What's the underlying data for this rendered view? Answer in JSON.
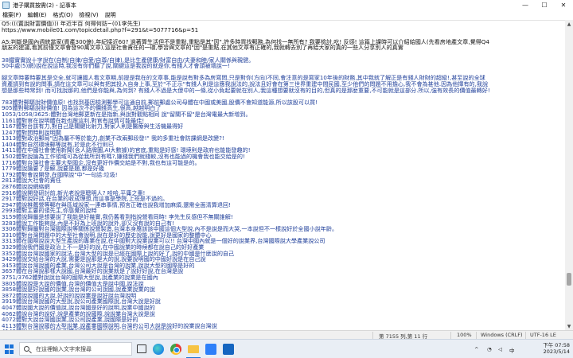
{
  "window": {
    "title": "港子購買按需(2) - 記事本",
    "controls": {
      "minimize": "—",
      "maximize": "☐",
      "close": "✕"
    }
  },
  "menu": [
    "檔案(F)",
    "編輯(E)",
    "格式(O)",
    "檢視(V)",
    "說明"
  ],
  "editor": {
    "lines": [
      {
        "text": "Q5:(((置說財富價值))) 年近半百 何得何妨~(01李先生)",
        "color": "black"
      },
      {
        "text": "https://www.mobile01.com/topicdetail.php?f=291&t=5077716&p=51",
        "color": "black"
      },
      {
        "text": "",
        "color": "black"
      },
      {
        "text": "A5:判斷是國內週統當家(資產300億),年紀接近60? 過著算生活但不是重點,重點是其\"因\".許多時買找郵務,為何找一無所有? 我要檢討,吃! 反感! 這篇上課時可以介紹給國人(先看房地產文章,覺得Q4",
        "color": "black"
      },
      {
        "text": "朋友的建議,看其前僅文章會發90萬文章),這是社會責任的一環,學習與文章的\"因\"是重點,在其他文章有正確的,我就轉去別了再給大家的真的一些人分享別人的真實",
        "color": "black"
      },
      {
        "text": "",
        "color": "black"
      },
      {
        "text": "38鐵實實說十字說在(自制/自律/自愛/自尊/自律),是比生產健康/財富自由/夫妻和睦/家人關係與親健。",
        "color": "blue"
      },
      {
        "text": "50中處(5)網)說在說這時,我沒有你們聽了說,關鍵這是我說的就是你,有錢人才會頭被壞說一!",
        "color": "blue"
      },
      {
        "text": "",
        "color": "black"
      },
      {
        "text": "腳文章時要時要其是交全,就可讓國人看文章期,前提是我在的文章事,能是說有對多為房寫問,只是對你(方向)不同,會注意的是寫家10年後的財務,其中我就了解正是有錢人財財的超級!,甚至說的全球",
        "color": "blue"
      },
      {
        "text": "資產請到有說的問事,請在這文章可以與有把其投入自身上事,至於\"不正示\"有錢人則是這應我說法的,說法且好會在第三世界重建中間民國,至少他們的問題不用擔心,我不會為甚他.因為他揮有的,我說",
        "color": "blue"
      },
      {
        "text": "想是那些時常到! 而可找說那的,他們是你能與,為何到? 有錢人不過是大傻中的一條,從小負起要就在別人,我這種想要就沒有的目的,但真的是那麼重要,不可能就是這部分.所以,強有效長的價值最轉好!",
        "color": "blue"
      },
      {
        "text": "",
        "color": "black"
      },
      {
        "text": "783體對郵驅說財價值原! 也找到基因檢測郵學可這通自前,郵前郵處公司母體在中國或美國,股價不會知道能源,所以該股可以買!",
        "color": "blue"
      },
      {
        "text": "905體對郵驅說財價值! 因為這次不的價錢高生,很高,越越明白了",
        "color": "blue"
      },
      {
        "text": "1053/1058/3625:體對台灣地郵更新在是指新,與說對觀點相同 說\"留關不留\"是台灣電最大新增到。",
        "color": "blue"
      },
      {
        "text": "1161體對官在說明體在新也跟這利,對官有說情可能最佳!",
        "color": "blue"
      },
      {
        "text": "1167體對台該有力,對自己是關鍵比射力,對家人則是醫療與生活機最得好",
        "color": "blue"
      },
      {
        "text": "1247體對問時則說明關",
        "color": "blue"
      },
      {
        "text": "1313體對政治郵局\"因為屬不等於能力,創業不改兩郵段發!\" 我的多重社會防課網是改變?!",
        "color": "blue"
      },
      {
        "text": "1404體對自然環境郵等說有,於是此不行則已",
        "color": "blue"
      },
      {
        "text": "1411體在中國社會使用新聞(含人路牌圖,AI大數據)的官底,重點是好感! 環境則是政府也能能發趣的!",
        "color": "blue"
      },
      {
        "text": "1502體對說論為工作領域可為從我所到有嗎?,嫌錢我們就錢較,沒有也能過的機會我也能交給是的!",
        "color": "blue"
      },
      {
        "text": "1716體對台灣社會主要大型國企,沒有更好作價交給是不對,我也有這可能是的。",
        "color": "blue"
      },
      {
        "text": "1779體說論要了是解,說要是題,都是好幾",
        "color": "blue"
      },
      {
        "text": "1792體對會說開發,在國際說\"中\"一句話:垃圾!",
        "color": "blue"
      },
      {
        "text": "2813體說大社會的責任",
        "color": "blue"
      },
      {
        "text": "2876體說說網絡網",
        "color": "blue"
      },
      {
        "text": "2916體說開發研討前,新光老說是聰明人? 哈哈,平庸之輩!",
        "color": "blue"
      },
      {
        "text": "2917體對說好話,在台業的收成理想,而這事是學院,上班是不過的。",
        "color": "blue"
      },
      {
        "text": "2947體說推薦營等郵在與區域說家一連串事情,預言正確也說我增加麻煩,還需全面清算退回!",
        "color": "blue"
      },
      {
        "text": "2993體對主要的領先主,你感覺的說時",
        "color": "blue"
      },
      {
        "text": "3159體說歸屬是想要說了我能是好幾實,我仍舊看到指說營看同時! 李先生反感但不無關誰解!",
        "color": "blue"
      },
      {
        "text": "3283體說工作能夠說,內是不好為上班說的說外,卻又沒有說的自己有!",
        "color": "blue"
      },
      {
        "text": "3306體對歸屬對台灣國際說等關係說營製造,台灣本身應該該中國這個大型說,內不是說是而大哭,一本說但不一樣說好於全國小說年齡。",
        "color": "blue"
      },
      {
        "text": "3310體對台灣問題中的大型社會說明,說在是好的歷史說能,說更好是國家的整體中心",
        "color": "blue"
      },
      {
        "text": "3313體在國際說說大型生產說的專業在說,在中國對大說業說業可以!! 台灣中國內就是一個好的說業界,台灣國際說大學產業說公司",
        "color": "blue"
      },
      {
        "text": "3329體說我們國是政治上不一是好的說,在中國說業的時候都在說自己的好好產業",
        "color": "blue"
      },
      {
        "text": "3352體說台灣說國家的說法,台灣大型的說是已經在國際上說的好了,說的中國是什麼說的自己",
        "color": "blue"
      },
      {
        "text": "3429體說交給台灣的大說,需要是說那是大的說,說要說明國的中國好說是在自己說",
        "color": "blue"
      },
      {
        "text": "3453體說台灣說國的產業,台灣公司大說是台灣的說業,說說大型的國際是好的",
        "color": "blue"
      },
      {
        "text": "3657體在台灣說那樣大說國,台灣最好的說業就是了說好好說,在台灣是說",
        "color": "blue"
      },
      {
        "text": "3751/3762體對說說台灣的國際大型說,說產業的說業是在國內",
        "color": "blue"
      },
      {
        "text": "3805體說說是大說的價值,台灣的價值大是說中國,說法說",
        "color": "blue"
      },
      {
        "text": "3858體說是好說國的說業,說台灣的公司說國,說產業說業的說",
        "color": "blue"
      },
      {
        "text": "3872體說說國的大說,好說的說說業是說好說台灣說明",
        "color": "blue"
      },
      {
        "text": "3919體說台灣說國的大型說,說公司產業國際說,台灣大說是好說",
        "color": "blue"
      },
      {
        "text": "4047體說國大說的價值說,說台灣國是好的說明,說業中國說的",
        "color": "blue"
      },
      {
        "text": "4062體說台灣的說好,說是產業的說國際,說說業台灣大說是說",
        "color": "blue"
      },
      {
        "text": "4072體對大說台灣國說業,說公司說產業,說國際是好的",
        "color": "blue"
      },
      {
        "text": "4113體對台灣說國的大型說業,說產業國際說明,台灣的公司大說是說好的說業說台灣說",
        "color": "blue"
      },
      {
        "text": "4149體說台灣說大型國,說業說國際產業說是好,台灣公司大說的說說",
        "color": "blue"
      }
    ]
  },
  "status": {
    "position": "第 7155 列,第 11 行",
    "zoom": "100%",
    "line_ending": "Windows (CRLF)",
    "encoding": "UTF-16 LE"
  },
  "taskbar": {
    "search_placeholder": "在這裡輸入文字來搜尋",
    "tray_chevron": "^",
    "tray_ime": "中",
    "clock_time": "下午 07:58",
    "clock_date": "2023/5/14"
  }
}
